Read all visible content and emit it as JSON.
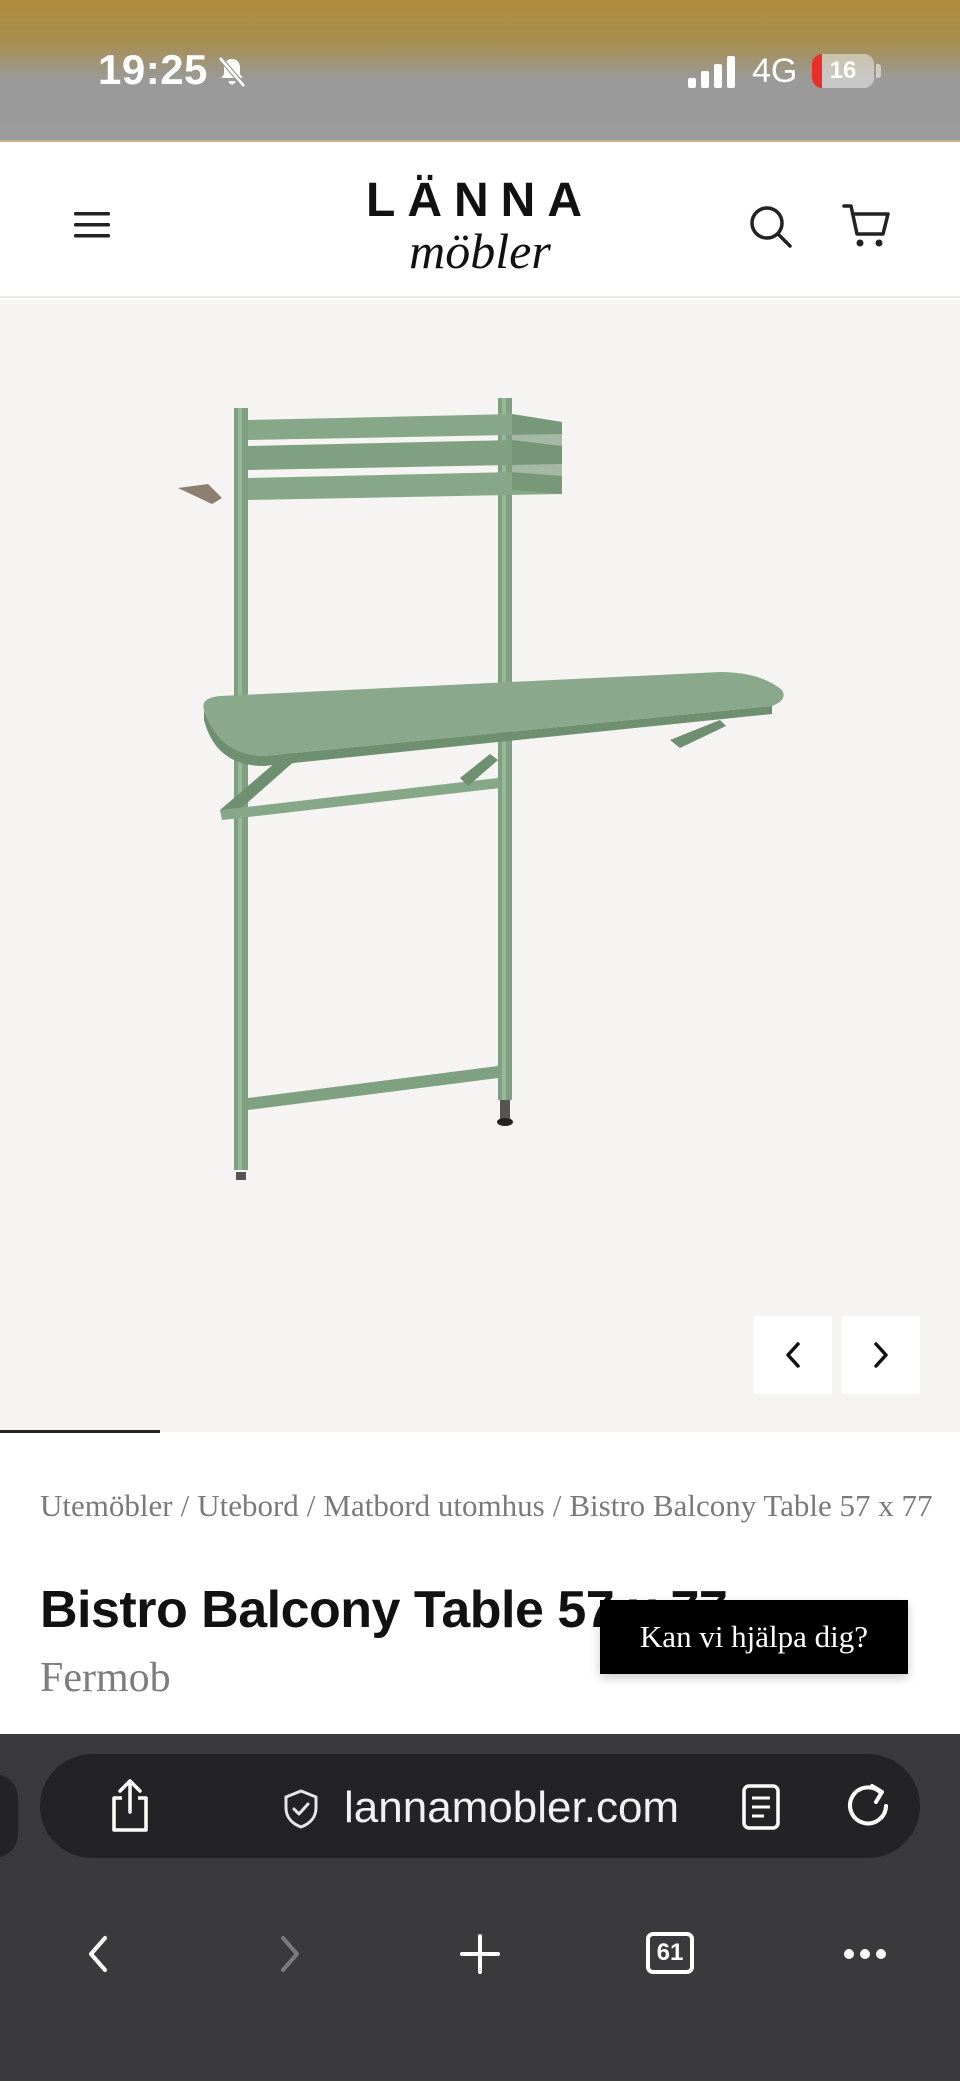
{
  "status_bar": {
    "time": "19:25",
    "network": "4G",
    "battery_level": "16",
    "battery_fraction": 0.16,
    "colors": {
      "battery_low": "#e8302a"
    }
  },
  "header": {
    "logo_top": "LÄNNA",
    "logo_bottom": "möbler",
    "icons": [
      "menu-icon",
      "search-icon",
      "cart-icon"
    ]
  },
  "gallery": {
    "prev_icon": "chevron-left-icon",
    "next_icon": "chevron-right-icon",
    "product_color": "#8aa98c"
  },
  "breadcrumb": {
    "items": [
      "Utemöbler",
      "Utebord",
      "Matbord utomhus",
      "Bistro Balcony Table 57 x 77"
    ],
    "separator": "/"
  },
  "product": {
    "title": "Bistro Balcony Table 57 x 77",
    "brand": "Fermob"
  },
  "help_chip": {
    "label": "Kan vi hjälpa dig?"
  },
  "browser": {
    "url": "lannamobler.com",
    "tabs_count": "61",
    "icons": [
      "share-icon",
      "shield-icon",
      "reader-icon",
      "reload-icon",
      "back-icon",
      "forward-icon",
      "new-tab-icon",
      "tabs-icon",
      "more-icon"
    ]
  }
}
